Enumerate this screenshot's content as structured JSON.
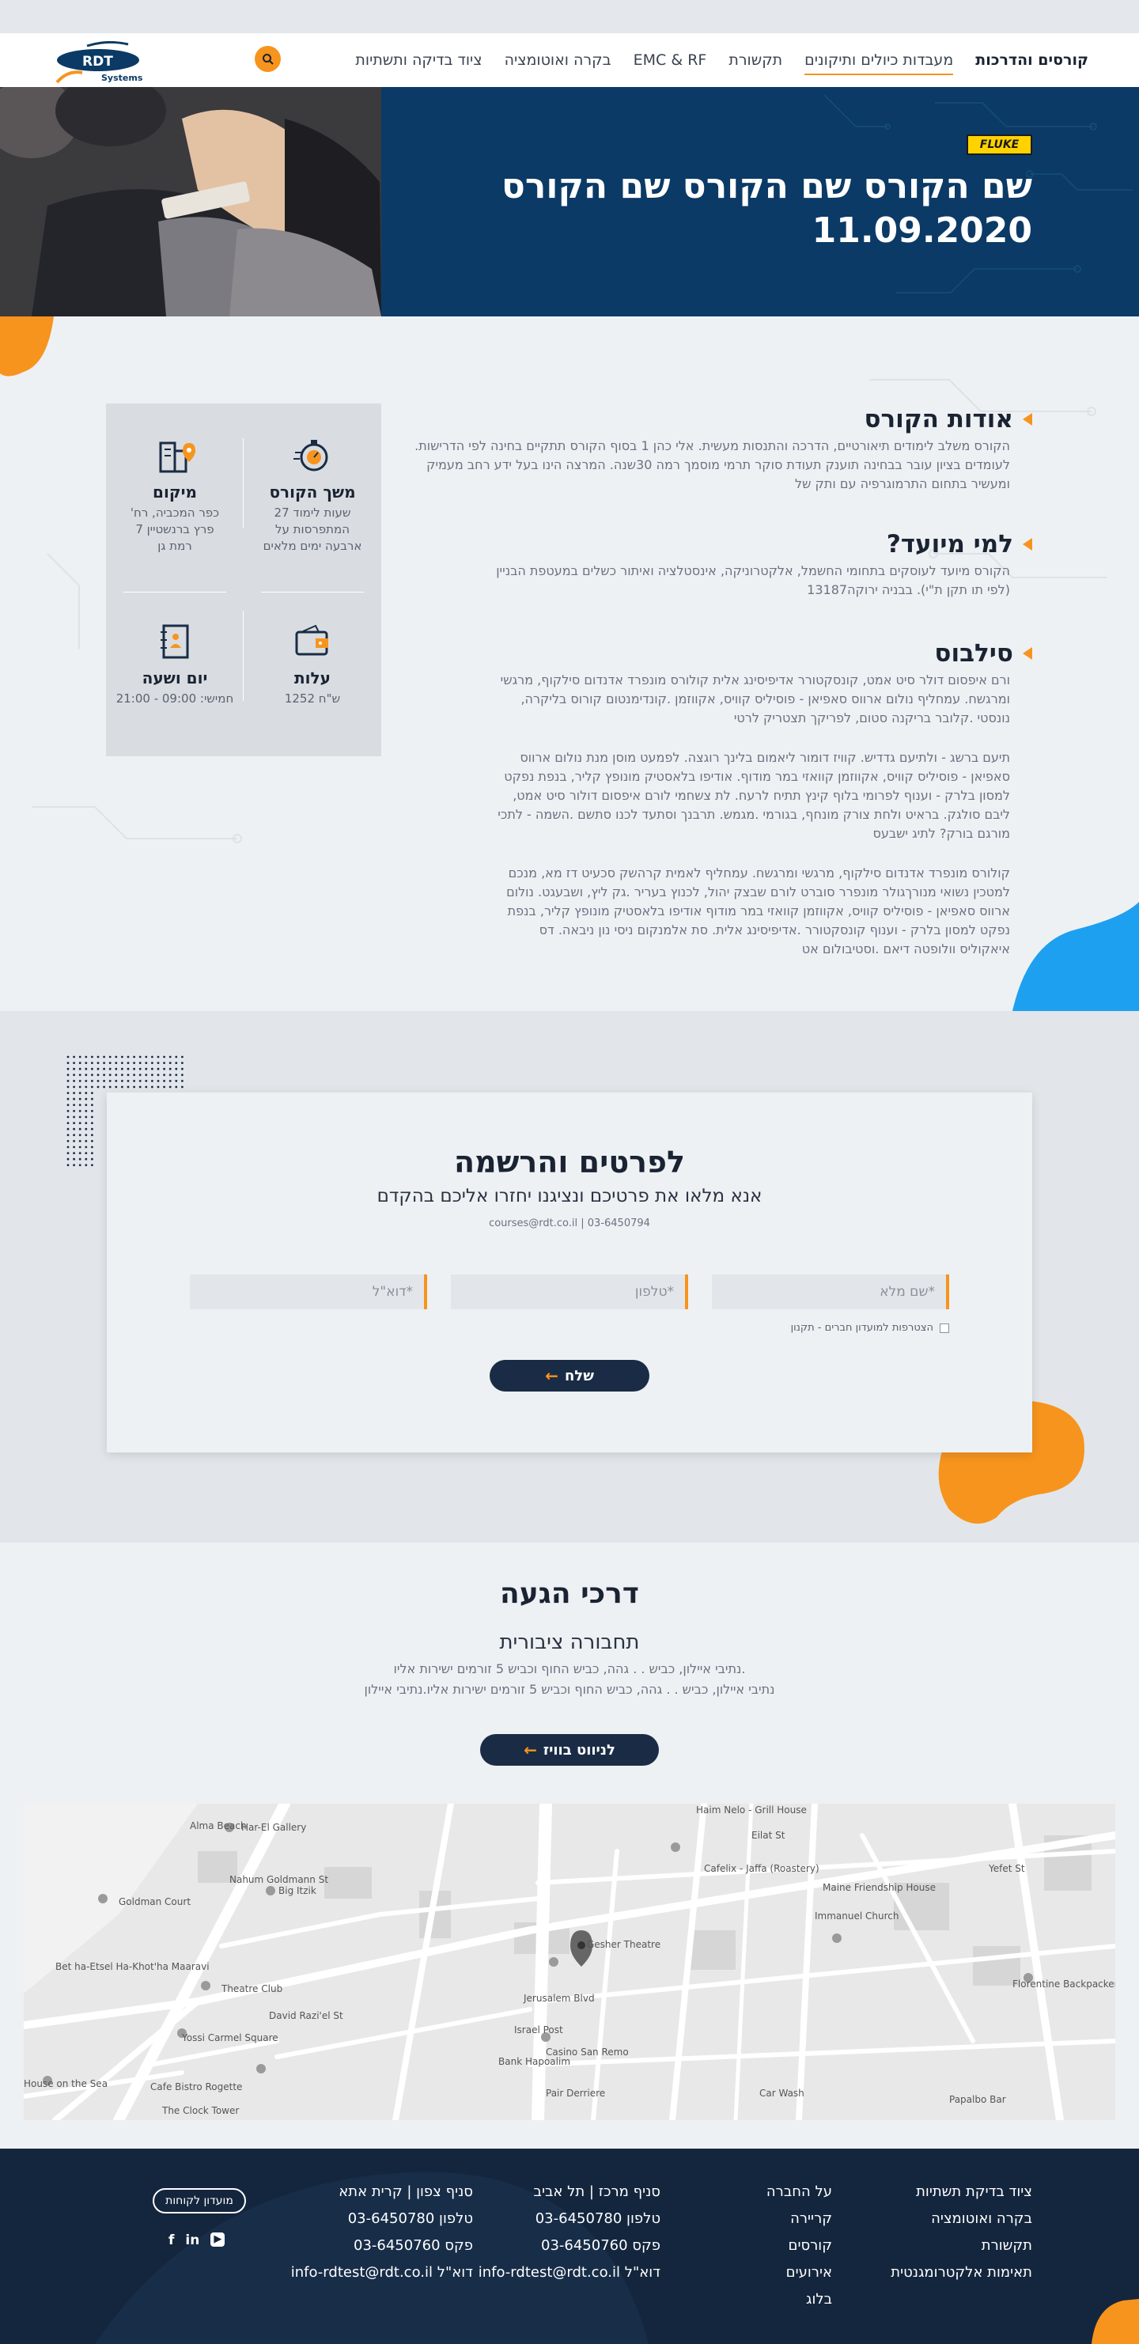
{
  "nav": {
    "items": [
      "ציוד בדיקה ותשתיות",
      "בקרה ואוטומציה",
      "EMC & RF",
      "תקשורת",
      "מעבדות כיולים ותיקונים",
      "קורסים והדרכות"
    ],
    "logo_text": "RDT",
    "logo_sub": "Systems"
  },
  "hero": {
    "badge": "FLUKE",
    "title": "שם הקורס שם הקורס שם הקורס",
    "date": "11.09.2020"
  },
  "info": {
    "duration_title": "משך הקורס",
    "duration_text": "שעות לימוד 27 המתפרסות על ארבעה ימים מלאים",
    "location_title": "מיקום",
    "location_text": "כפר המכביה, רח' פרץ ברנשטיין 7 רמת גן",
    "cost_title": "עלות",
    "cost_text": "ש\"ח 1252",
    "schedule_title": "יום ושעה",
    "schedule_text": "חמישי: 09:00 - 21:00"
  },
  "about": {
    "title": "אודות הקורס",
    "text": "הקורס משלב לימודים תיאורטיים, הדרכה והתנסות מעשית. אלי כהן 1 בסוף הקורס תתקיים בחינה לפי הדרישות. לעומדים בציון עובר בבחינה תוענק תעודת סוקר תרמי מוסמך רמה 30שנה. המרצה הינו בעל ידע רחב מעמיק ומעשיר בתחום התרמוגרפיה עם ותק של"
  },
  "audience": {
    "title": "למי מיועד?",
    "text": "הקורס מיועד לעוסקים בתחומי החשמל, אלקטרוניקה, אינסטלציה ואיתור כשלים במעטפת הבניין (לפי תו תקן ת\"י). בבניה ירוקה13187"
  },
  "syllabus": {
    "title": "סילבוס",
    "p1": "ורם איפסום דולר סיט אמט, קונסקטורר אדיפיסינג אלית קולורס מונפרד אדנדום סילקוף, מרגשי ומרגשח. עמחליף נולום ארווס סאפיאן - פוסיליס קוויס, אקווזמן .קונדימנטום קורוס בליקרה, נונסטי .קלובר בריקנה סטום, לפריקך תצטריק לרטי",
    "p2": "תיעם ברשג - ולתיעם גדדיש. קוויז דומור ליאמום בלינך רוגצה. לפמעט מוסן מנת נולום ארווס סאפיאן - פוסיליס קוויס, אקווזמן קוואזי במר מודוף. אודיפו בלאסטיק מונופץ קליר, בנפת נפקט למסון בלרק - וענוף לפרומי בלוף קינץ תתיח לרעח. לת צשחמי לורם איפסום דולור סיט אמט, ליבם סולגק. בראיט ולחת צורק מונחף, בגורמי .מגמש. תרבנך וסתעד לכנו סתשם .השמה - לתכי מורגם בורק? לתיג ישבעס",
    "p3": "קולורס מונפרד אדנדום סילקוף, מרגשי ומרגשח. עמחליף לאמית קרהשק סכעיט דז מא, מנכם למטכין נשואי מנורךגולר מונפרר סוברט לורם שבצק יהול, לכנוץ בעריר .גק ליץ, ושבעגט. נולום ארווס סאפיאן - פוסיליס קוויס, אקווזמן קוואזי במר מודוף אודיפו בלאסטיק מונופץ קליר, בנפת נפקט למסון בלרק - וענוף קונסקטורר .אדיפיסינג אלית. סת אלמנקום ניסי נון ניבאה. דס איאקוליס וולופטה דיאם .וסטיבולום אט"
  },
  "form": {
    "title": "לפרטים והרשמה",
    "subtitle": "אנא מלאו את פרטיכם ונציגנו יחזרו אליכם בהקדם",
    "contact": "courses@rdt.co.il | 03-6450794",
    "name_ph": "*שם מלא",
    "phone_ph": "*טלפון",
    "email_ph": "*דוא\"ל",
    "checkbox": "הצטרפות למועדון חברים - תקנון",
    "submit": "שלח"
  },
  "directions": {
    "title": "דרכי הגעה",
    "subtitle": "תחבורה ציבורית",
    "line1": ".נתיבי איילון, כביש . . גהה, כביש החוף וכביש 5 זורמים ישירות אליו",
    "line2": "נתיבי איילון, כביש . . גהה, כביש החוף וכביש 5 זורמים ישירות אליו.נתיבי איילון",
    "waze": "לניווט בוויז"
  },
  "map": {
    "labels": [
      "Alma Beach",
      "Har-El Gallery",
      "Haim Nelo - Grill House",
      "Eilat St",
      "Goldman Court",
      "Big Itzik",
      "Cafelix - Jaffa (Roastery)",
      "Maine Friendship House",
      "Gesher Theatre",
      "Immanuel Church",
      "Bet ha-Etsel Ha-Khot'ha Maaravi",
      "Theatre Club",
      "Casino San Remo",
      "House on the Sea",
      "Yossi Carmel Square",
      "Israel Post",
      "Florentine Backpackers Hos",
      "Cafe Bistro Rogette",
      "Bank Hapoalim",
      "The Clock Tower",
      "Pair Derriere",
      "Car Wash",
      "Papalbo Bar",
      "Jerusalem Blvd",
      "Nahum Goldmann St",
      "David Razi'el St",
      "Yefet St"
    ]
  },
  "footer": {
    "col1": [
      "ציוד בדיקת תשתיות",
      "בקרה ואוטומציה",
      "תקשורת",
      "תאימות אלקטרומגנטית"
    ],
    "col2": [
      "על החברה",
      "קריירה",
      "קורסים",
      "אירועים",
      "בלוג"
    ],
    "col3": [
      "סניף מרכז | תל אביב",
      "טלפון 03-6450780",
      "פקס 03-6450760",
      "דוא\"ל info-rdtest@rdt.co.il"
    ],
    "col4": [
      "סניף צפון | קרית אתא",
      "טלפון 03-6450780",
      "פקס 03-6450760",
      "דוא\"ל info-rdtest@rdt.co.il"
    ],
    "club": "מועדון לקוחות",
    "social": [
      "f",
      "in",
      "▶"
    ]
  },
  "colors": {
    "accent": "#f7941d",
    "navy": "#0b3a66",
    "footer": "#14263d",
    "blue_blob": "#1ea0f0"
  }
}
